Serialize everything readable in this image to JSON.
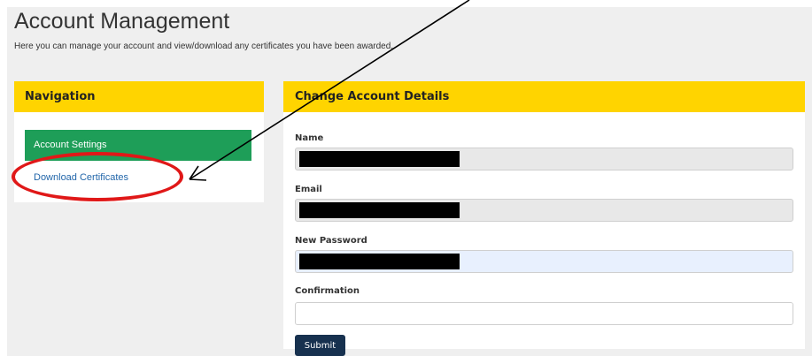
{
  "header": {
    "title": "Account Management",
    "subtitle": "Here you can manage your account and view/download any certificates you have been awarded."
  },
  "navigation": {
    "title": "Navigation",
    "items": [
      {
        "label": "Account Settings",
        "active": true
      },
      {
        "label": "Download Certificates",
        "active": false
      }
    ]
  },
  "form": {
    "title": "Change Account Details",
    "fields": [
      {
        "label": "Name",
        "value": ""
      },
      {
        "label": "Email",
        "value": ""
      },
      {
        "label": "New Password",
        "value": ""
      },
      {
        "label": "Confirmation",
        "value": ""
      }
    ],
    "submit_label": "Submit"
  },
  "colors": {
    "panel_header": "#ffd400",
    "nav_active": "#1e9e58",
    "submit": "#17314f",
    "annotation": "#e01818"
  }
}
